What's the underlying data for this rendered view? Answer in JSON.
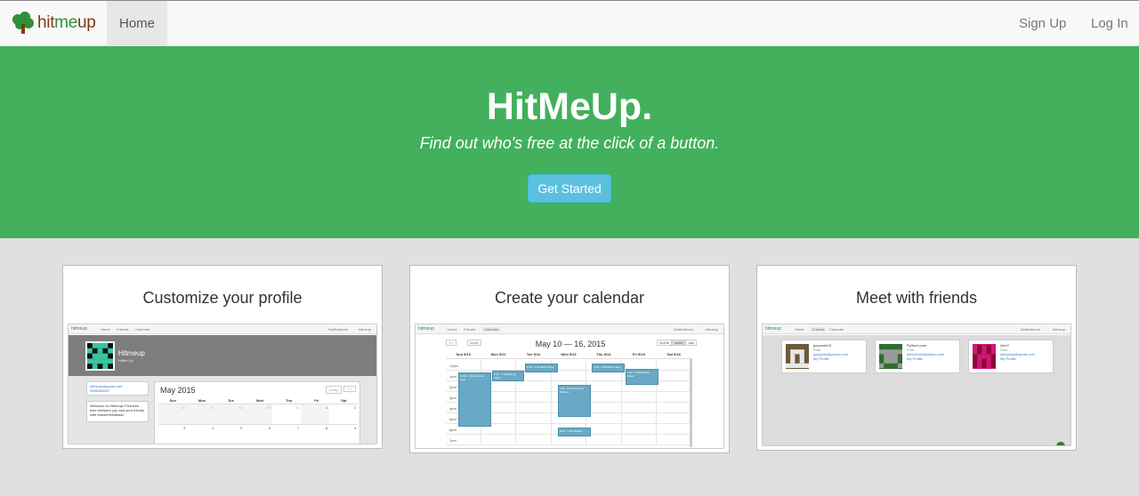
{
  "navbar": {
    "brand": {
      "part1": "hit",
      "part2": "me",
      "part3": "up"
    },
    "home_label": "Home",
    "signup_label": "Sign Up",
    "login_label": "Log In"
  },
  "hero": {
    "title": "HitMeUp.",
    "subtitle": "Find out who's free at the click of a button.",
    "cta_label": "Get Started"
  },
  "cards": [
    {
      "title": "Customize your profile",
      "mini_nav": [
        "hitmeup",
        "Home",
        "Friends",
        "Calendar",
        "Notifications",
        "hitmeup"
      ],
      "profile_name": "Hitmeup",
      "profile_sub": "HitMe Up",
      "email": "hitmeup@gmail.com",
      "phone": "5555488097",
      "about": "Welcome to Hitmeup! Find free time between you and your friends with instant feedback!",
      "calendar_title": "May 2015",
      "today_label": "today",
      "weekdays": [
        "Sun",
        "Mon",
        "Tue",
        "Wed",
        "Thu",
        "Fri",
        "Sat"
      ],
      "week1": [
        "26",
        "27",
        "28",
        "29",
        "30",
        "1",
        "2"
      ],
      "week2": [
        "3",
        "4",
        "5",
        "6",
        "7",
        "8",
        "9"
      ]
    },
    {
      "title": "Create your calendar",
      "mini_nav": [
        "hitmeup",
        "Home",
        "Friends",
        "Calendar",
        "Notifications",
        "hitmeup"
      ],
      "calendar_title": "May 10 — 16, 2015",
      "today_label": "today",
      "views": [
        "month",
        "week",
        "day"
      ],
      "days": [
        "Sun 5/10",
        "Mon 5/11",
        "Tue 5/12",
        "Wed 5/13",
        "Thu 5/14",
        "Fri 5/15",
        "Sat 5/16"
      ],
      "times": [
        "12pm",
        "1pm",
        "2pm",
        "3pm",
        "4pm",
        "5pm",
        "6pm",
        "7pm"
      ],
      "events": [
        "12:00 - 5:00 Journal Club",
        "1:00 - 2:00 Biology Class",
        "1:00 - 2:00 Math Class",
        "2:00 - 5:00 Study for Midterm",
        "1:00 - 2:00 Math Class",
        "1:00 - 2:00 Biology Class",
        "6:00 - 7:00 Midterm"
      ]
    },
    {
      "title": "Meet with friends",
      "mini_nav": [
        "hitmeup",
        "Home",
        "Friends",
        "Calendar",
        "Notifications",
        "hitmeup"
      ],
      "friends": [
        {
          "name": "gopower03",
          "status": "Free",
          "email": "gopower@yahoo.com",
          "link": "My Profile"
        },
        {
          "name": "PythonLover",
          "status": "Free",
          "email": "danrohmsl@yahoo.com",
          "link": "My Profile"
        },
        {
          "name": "AlexT",
          "status": "Free",
          "email": "alexyshie@gmail.com",
          "link": "My Profile"
        }
      ]
    }
  ],
  "colors": {
    "hero_bg": "#42b05d",
    "cta_bg": "#5bc0de",
    "page_bg": "#e0e0e0",
    "event_bg": "#68a9c6"
  }
}
